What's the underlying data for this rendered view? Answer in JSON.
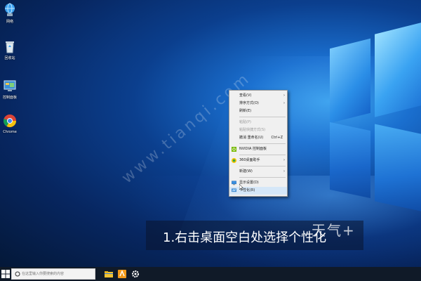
{
  "desktop": {
    "icons": [
      {
        "label": "网络"
      },
      {
        "label": "回收站"
      },
      {
        "label": "控制面板"
      },
      {
        "label": "Chrome"
      }
    ],
    "watermark": "www.tianqi.com"
  },
  "context_menu": {
    "items": [
      {
        "label": "查看(V)",
        "submenu": true
      },
      {
        "label": "排序方式(O)",
        "submenu": true
      },
      {
        "label": "刷新(E)"
      },
      {
        "label": "粘贴(P)",
        "disabled": true
      },
      {
        "label": "粘贴快捷方式(S)",
        "disabled": true
      },
      {
        "label": "撤消 重命名(U)",
        "shortcut": "Ctrl+Z"
      },
      {
        "label": "NVIDIA 控制面板",
        "icon": "nvidia-icon"
      },
      {
        "label": "360桌面助手",
        "icon": "360-icon",
        "submenu": true
      },
      {
        "label": "新建(W)",
        "submenu": true
      },
      {
        "label": "显示设置(D)",
        "icon": "display-icon"
      },
      {
        "label": "个性化(R)",
        "icon": "personalize-icon",
        "highlighted": true
      }
    ]
  },
  "subtitle": "1.右击桌面空白处选择个性化",
  "brand_logo": "天气+",
  "taskbar": {
    "search_placeholder": "在这里输入你要搜索的内容",
    "apps": [
      "file-explorer-icon",
      "app-icon",
      "settings-icon"
    ]
  },
  "colors": {
    "accent": "#1a6fcf",
    "taskbar": "#101a28",
    "menu_bg": "#f0f0f0",
    "menu_highlight": "#d5e7f8"
  }
}
